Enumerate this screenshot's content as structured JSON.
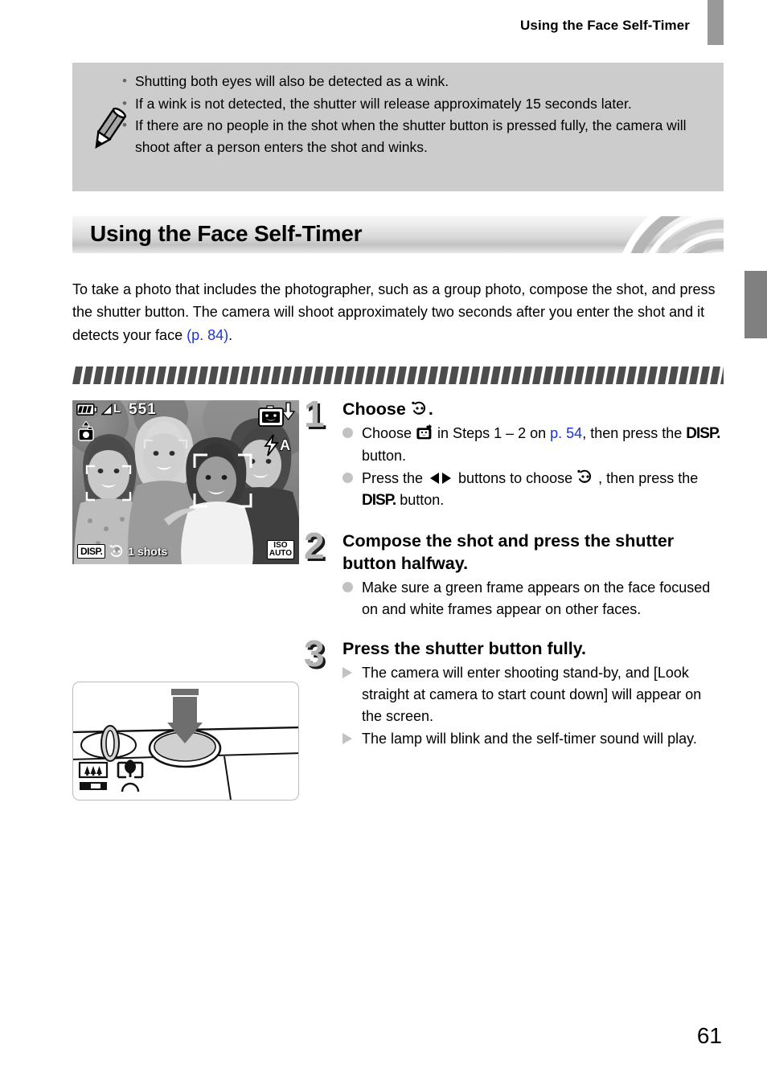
{
  "header": {
    "title": "Using the Face Self-Timer",
    "tab_icon": "page-tab-marker"
  },
  "note_box": {
    "icon": "pencil-icon",
    "items": [
      "Shutting both eyes will also be detected as a wink.",
      "If a wink is not detected, the shutter will release approximately 15 seconds later.",
      "If there are no people in the shot when the shutter button is pressed fully,  the camera will shoot after a person enters the shot and winks."
    ],
    "bullet": "•"
  },
  "section": {
    "title": "Using the Face Self-Timer",
    "intro_before_link": "To take a photo that includes the photographer, such as a group photo, compose the shot, and press the shutter button. The camera will shoot approximately two seconds after you enter the shot and it detects your face ",
    "intro_link": "(p. 84)",
    "intro_after_link": "."
  },
  "lcd_screen": {
    "battery": "battery-full-icon",
    "quality": "L",
    "quality_icon": "compression-fine-icon",
    "shots_remaining": "551",
    "mode_icon": "shooting-mode-icon",
    "face_self_timer_icon": "face-self-timer-mode-icon",
    "flash": "flash-auto-icon",
    "flash_label": "A",
    "disp_label": "DISP.",
    "self_timer_icon": "face-self-timer-icon",
    "shot_count": "1 shots",
    "iso_line1": "ISO",
    "iso_line2": "AUTO"
  },
  "camera_figure": {
    "name": "shutter-button-press-diagram",
    "arrow": "down-arrow-press-indicator",
    "macro_icon": "macro-landscape-icon",
    "zoom_icon": "zoom-wide-tele-icon"
  },
  "steps": [
    {
      "number": "1",
      "heading_before_icon": "Choose ",
      "heading_icon": "face-self-timer-icon",
      "heading_after_icon": ".",
      "sub_items": [
        {
          "marker": "dot",
          "parts": [
            {
              "type": "text",
              "value": "Choose "
            },
            {
              "type": "icon",
              "value": "self-timer-menu-icon"
            },
            {
              "type": "text",
              "value": " in Steps 1 – 2 on "
            },
            {
              "type": "link",
              "value": "p. 54"
            },
            {
              "type": "text",
              "value": ", then press the "
            },
            {
              "type": "disp",
              "value": "DISP."
            },
            {
              "type": "text",
              "value": " button."
            }
          ]
        },
        {
          "marker": "dot",
          "parts": [
            {
              "type": "text",
              "value": "Press the "
            },
            {
              "type": "icon",
              "value": "left-right-buttons-icon"
            },
            {
              "type": "text",
              "value": " buttons to choose "
            },
            {
              "type": "icon",
              "value": "face-self-timer-icon"
            },
            {
              "type": "text",
              "value": " , then press the "
            },
            {
              "type": "disp",
              "value": "DISP."
            },
            {
              "type": "text",
              "value": " button."
            }
          ]
        }
      ]
    },
    {
      "number": "2",
      "heading": "Compose the shot and press the shutter button halfway.",
      "sub_items": [
        {
          "marker": "dot",
          "parts": [
            {
              "type": "text",
              "value": "Make sure a green frame appears on the face focused on and white frames appear on other faces."
            }
          ]
        }
      ]
    },
    {
      "number": "3",
      "heading": "Press the shutter button fully.",
      "sub_items": [
        {
          "marker": "triangle",
          "parts": [
            {
              "type": "text",
              "value": "The camera will enter shooting stand-by, and [Look straight at camera to start count down] will appear on the screen."
            }
          ]
        },
        {
          "marker": "triangle",
          "parts": [
            {
              "type": "text",
              "value": "The lamp will blink and the self-timer sound will play."
            }
          ]
        }
      ]
    }
  ],
  "page_number": "61",
  "colors": {
    "note_box_bg": "#cccccc",
    "link": "#1a33dd",
    "tab_gray": "#808080",
    "header_tab_gray": "#999999",
    "step_number_gray": "#b3b3b3",
    "marker_gray": "#c2c2c2"
  }
}
